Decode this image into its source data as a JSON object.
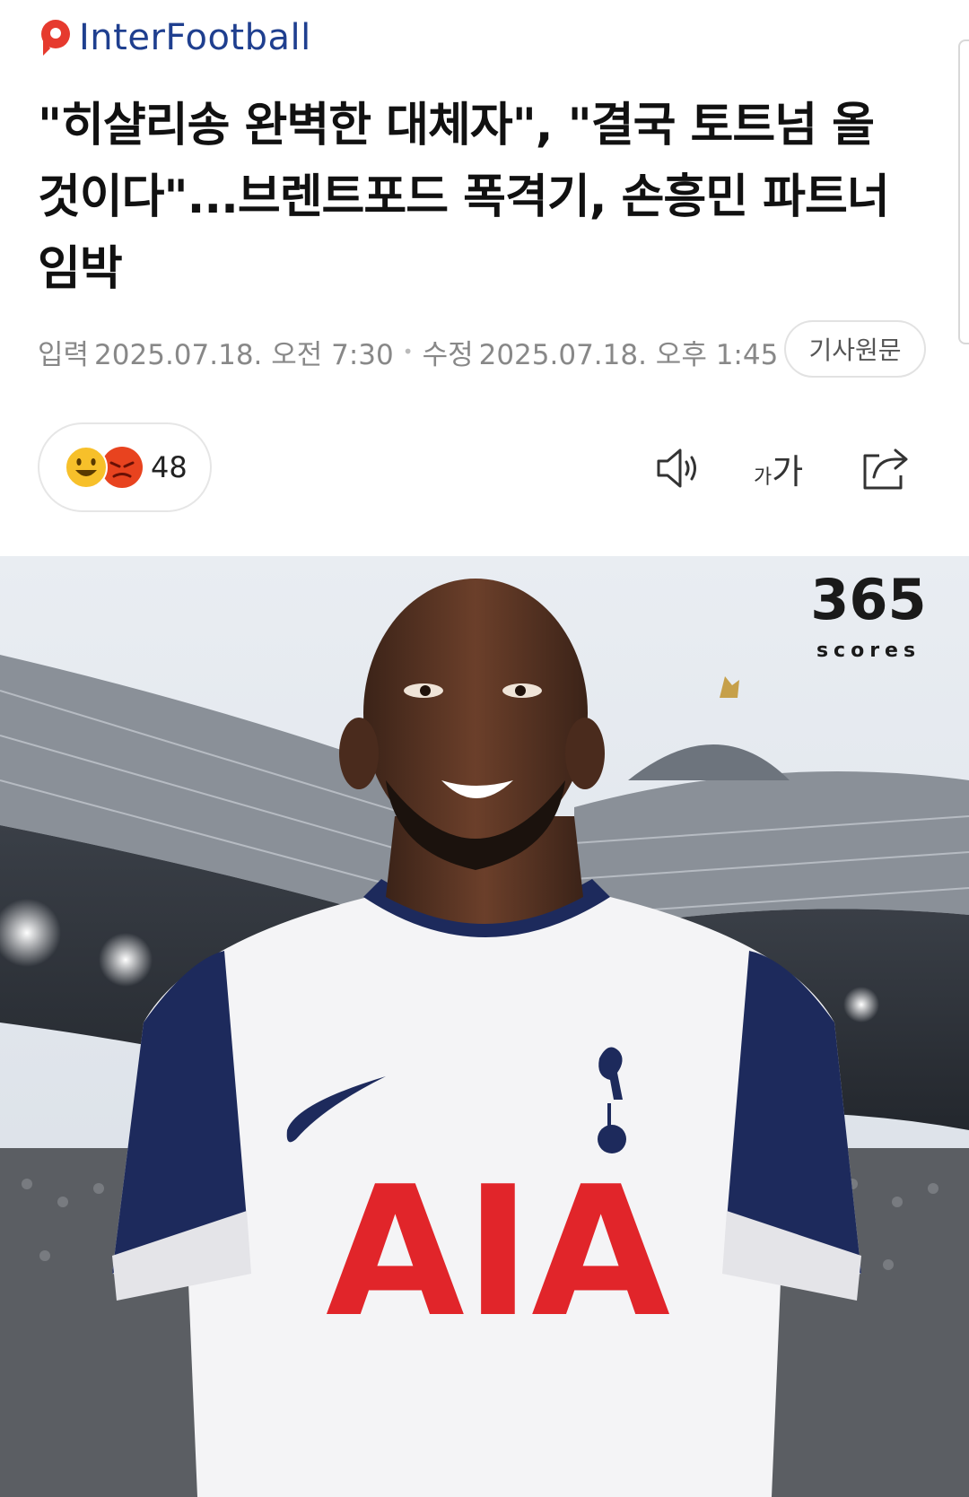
{
  "brand": {
    "name": "InterFootball",
    "color": "#1f3f8f",
    "accent": "#e63a2e"
  },
  "article": {
    "title": "\"히샬리송 완벽한 대체자\", \"결국 토트넘 올 것이다\"...브렌트포드 폭격기, 손흥민 파트너 임박",
    "published_label": "입력",
    "published": "2025.07.18. 오전 7:30",
    "modified_label": "수정",
    "modified": "2025.07.18. 오후 1:45",
    "original_button": "기사원문"
  },
  "toolbar": {
    "reaction_count": "48",
    "icons": [
      "smile-emoji-icon",
      "angry-emoji-icon",
      "speaker-icon",
      "font-size-icon",
      "share-icon"
    ],
    "font_size_small": "가",
    "font_size_large": "가"
  },
  "photo": {
    "watermark_number": "365",
    "watermark_text": "scores",
    "jersey_sponsor": "AIA",
    "icons": [
      "nike-swoosh-icon",
      "cockerel-crest-icon"
    ]
  }
}
